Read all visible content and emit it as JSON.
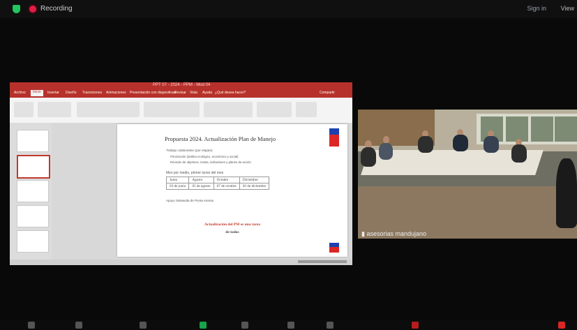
{
  "topbar": {
    "recording_label": "Recording",
    "signin_label": "Sign in",
    "view_label": "View"
  },
  "powerpoint": {
    "window_title": "PPT 07 - 2024 - PPM - Mod 04",
    "tabs": [
      "Archivo",
      "Inicio",
      "Insertar",
      "Diseño",
      "Transiciones",
      "Animaciones",
      "Presentación con diapositivas",
      "Revisar",
      "Vista",
      "Ayuda",
      "¿Qué desea hacer?"
    ],
    "active_tab_index": 1,
    "share_label": "Compartir",
    "slide_count": 6
  },
  "slide": {
    "title": "Propuesta 2024. Actualización Plan de Manejo",
    "intro": "Trabajo colaborativo (por etapas):",
    "bullets": [
      "Priorización (ámbito ecológico, económico y social)",
      "Revisión de objetivos, metas, indicadores y planes de acción"
    ],
    "subheading": "Mes por medio, primer lunes del mes",
    "dates_table": [
      [
        "Junio",
        "Agosto",
        "Octubre",
        "Diciembre"
      ],
      [
        "03 de junio",
        "05 de agosto",
        "07 de octubre",
        "02 de diciembre"
      ]
    ],
    "note": "Apoyo Salvavida de Punta Arenas",
    "highlight_red": "Actualización del PM es una tarea",
    "highlight_dark": "de todos"
  },
  "video": {
    "participant_name": "asesorias mandujano"
  },
  "colors": {
    "ppt_red": "#b7312c",
    "rec_red": "#e11d48",
    "shield_green": "#22c55e"
  },
  "toolbar_icons": [
    "mute-icon",
    "video-icon",
    "participants-icon",
    "share-icon",
    "chat-icon",
    "record-icon",
    "reactions-icon",
    "apps-icon",
    "leave-icon"
  ]
}
